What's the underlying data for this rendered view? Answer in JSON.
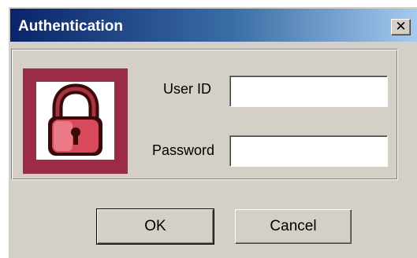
{
  "window": {
    "title": "Authentication",
    "close_glyph": "✕"
  },
  "icon": {
    "name": "padlock-icon",
    "frame_color": "#9c2b45"
  },
  "form": {
    "user_id_label": "User ID",
    "user_id_value": "",
    "password_label": "Password",
    "password_value": ""
  },
  "buttons": {
    "ok_label": "OK",
    "cancel_label": "Cancel"
  },
  "colors": {
    "titlebar_start": "#0a246a",
    "titlebar_end": "#a6caf0",
    "face": "#d4d0c8"
  }
}
